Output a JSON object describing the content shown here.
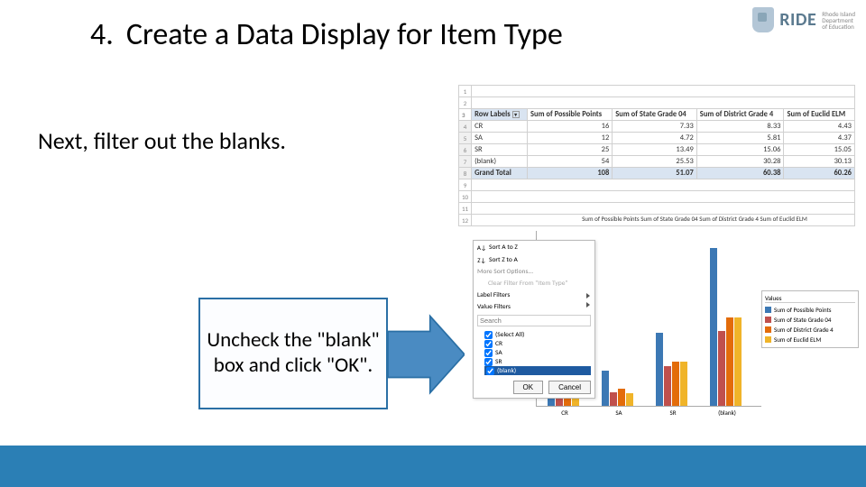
{
  "header": {
    "step_number": "4.",
    "step_title": "Create a Data Display for Item Type",
    "logo_text": "RIDE",
    "logo_sub1": "Rhode Island",
    "logo_sub2": "Department",
    "logo_sub3": "of Education"
  },
  "subtext": "Next, filter out the blanks.",
  "callout": "Uncheck the \"blank\" box and click \"OK\".",
  "pivot": {
    "header_row_label": "Row Labels",
    "col_headers": [
      "Sum of Possible Points",
      "Sum of State Grade 04",
      "Sum of District Grade 4",
      "Sum of Euclid ELM"
    ],
    "rows": [
      {
        "label": "CR",
        "vals": [
          "16",
          "7.33",
          "8.33",
          "4.43"
        ]
      },
      {
        "label": "SA",
        "vals": [
          "12",
          "4.72",
          "5.81",
          "4.37"
        ]
      },
      {
        "label": "SR",
        "vals": [
          "25",
          "13.49",
          "15.06",
          "15.05"
        ]
      },
      {
        "label": "(blank)",
        "vals": [
          "54",
          "25.53",
          "30.28",
          "30.13"
        ]
      }
    ],
    "grand_label": "Grand Total",
    "grand_vals": [
      "108",
      "51.07",
      "60.38",
      "60.26"
    ]
  },
  "chart_data": {
    "type": "bar",
    "categories": [
      "CR",
      "SA",
      "SR",
      "(blank)"
    ],
    "series": [
      {
        "name": "Sum of Possible Points",
        "values": [
          16,
          12,
          25,
          54
        ],
        "color": "#3c78b4"
      },
      {
        "name": "Sum of State Grade 04",
        "values": [
          7.33,
          4.72,
          13.49,
          25.53
        ],
        "color": "#c0504d"
      },
      {
        "name": "Sum of District Grade 4",
        "values": [
          8.33,
          5.81,
          15.06,
          30.28
        ],
        "color": "#e36c0a"
      },
      {
        "name": "Sum of Euclid ELM",
        "values": [
          4.43,
          4.37,
          15.05,
          30.13
        ],
        "color": "#f0b429"
      }
    ],
    "ylim": [
      0,
      60
    ],
    "legend_top": "Sum of Possible Points  Sum of State Grade 04  Sum of District Grade 4  Sum of Euclid ELM",
    "legend_title": "Values"
  },
  "filter": {
    "sort_az": "Sort A to Z",
    "sort_za": "Sort Z to A",
    "more_sort": "More Sort Options...",
    "clear_filter": "Clear Filter From \"Item Type\"",
    "label_filters": "Label Filters",
    "value_filters": "Value Filters",
    "search_placeholder": "Search",
    "items": [
      {
        "label": "(Select All)",
        "checked": true
      },
      {
        "label": "CR",
        "checked": true
      },
      {
        "label": "SA",
        "checked": true
      },
      {
        "label": "SR",
        "checked": true
      },
      {
        "label": "(blank)",
        "checked": true,
        "selected": true
      }
    ],
    "ok": "OK",
    "cancel": "Cancel"
  }
}
